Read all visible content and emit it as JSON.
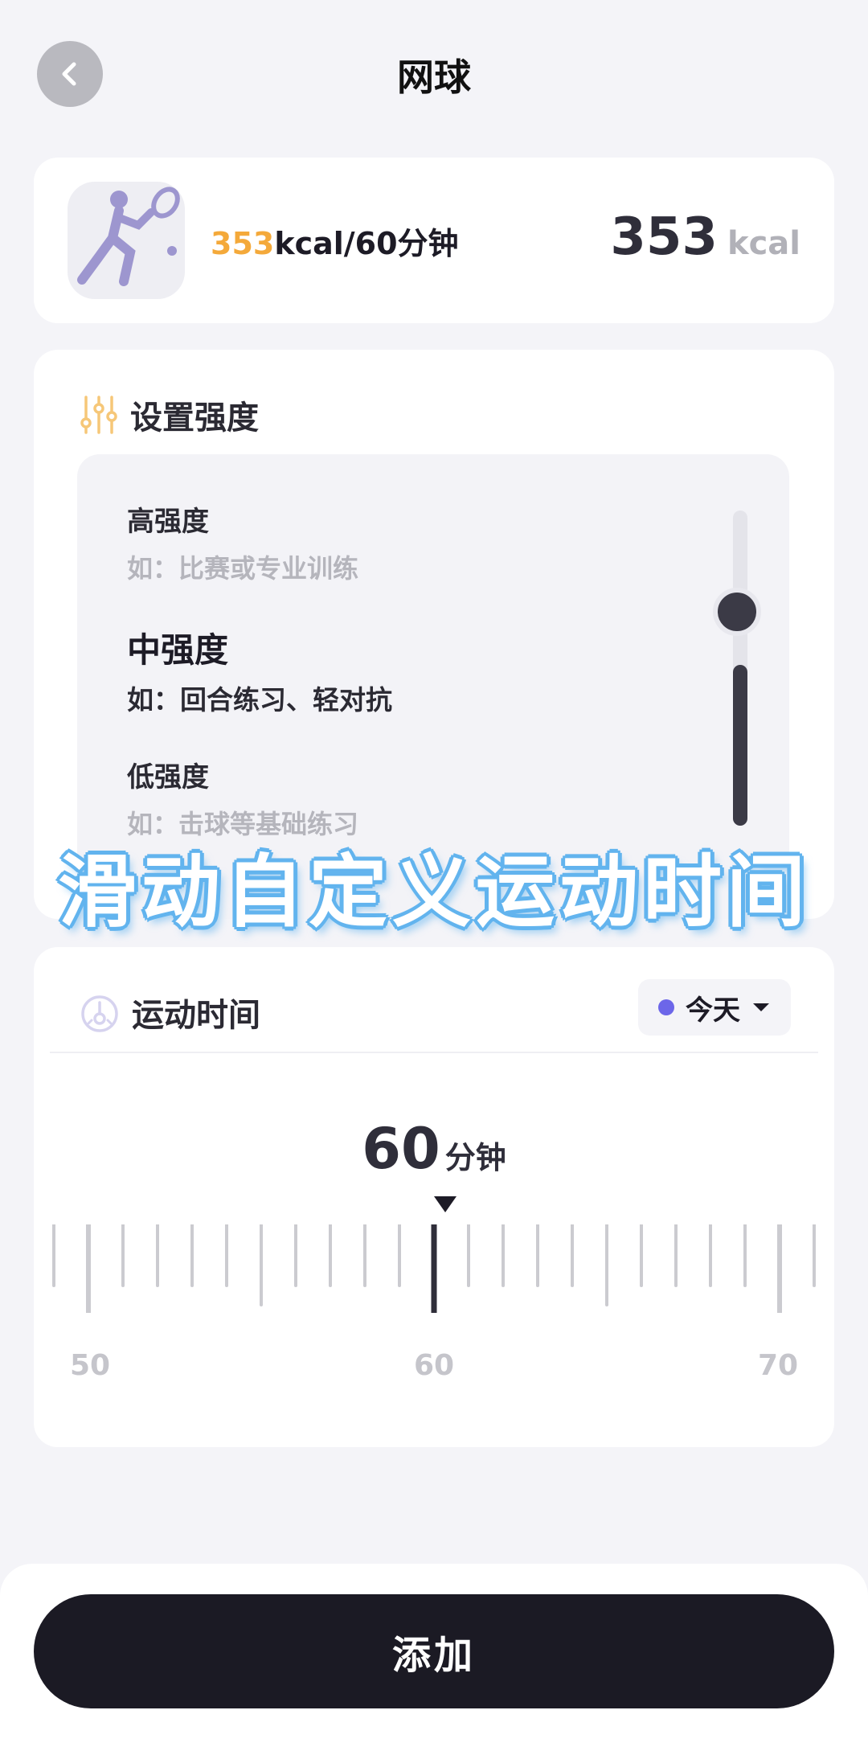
{
  "header": {
    "title": "网球"
  },
  "summary": {
    "rate_value": "353",
    "rate_suffix": "kcal/60分钟",
    "total_value": "353",
    "total_unit": "kcal",
    "icon": "tennis-player-icon",
    "accent_color": "#f4a93a"
  },
  "intensity": {
    "section_label": "设置强度",
    "icon": "sliders-icon",
    "options": [
      {
        "name": "高强度",
        "desc": "如：比赛或专业训练"
      },
      {
        "name": "中强度",
        "desc": "如：回合练习、轻对抗"
      },
      {
        "name": "低强度",
        "desc": "如：击球等基础练习"
      }
    ],
    "selected_level": "中强度"
  },
  "caption": "滑动自定义运动时间",
  "time": {
    "section_label": "运动时间",
    "icon": "stopwatch-icon",
    "day_label": "今天",
    "value": "60",
    "unit": "分钟",
    "ruler_labels": [
      "50",
      "60",
      "70"
    ]
  },
  "footer": {
    "add_label": "添加",
    "button_color": "#1b1a24"
  }
}
